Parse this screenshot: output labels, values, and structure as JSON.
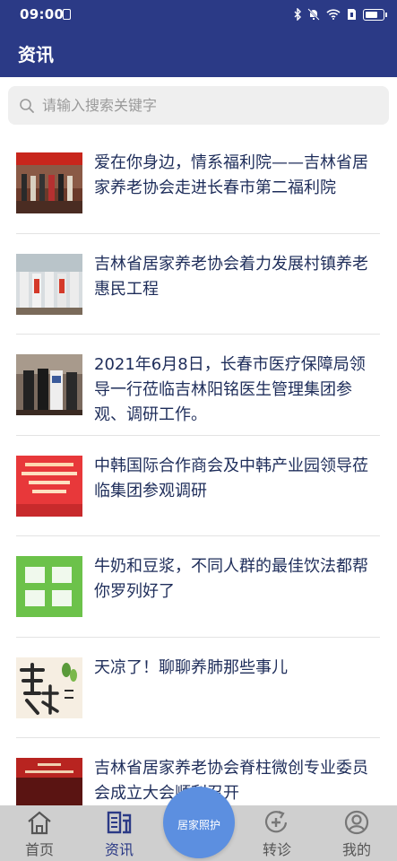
{
  "status_bar": {
    "time": "09:00"
  },
  "header": {
    "title": "资讯"
  },
  "search": {
    "placeholder": "请输入搜索关键字"
  },
  "news": [
    {
      "title": "爱在你身边，情系福利院——吉林省居家养老协会走进长春市第二福利院",
      "thumb": "event-photo-red-banner"
    },
    {
      "title": "吉林省居家养老协会着力发展村镇养老惠民工程",
      "thumb": "volunteers-photo"
    },
    {
      "title": "2021年6月8日，长春市医疗保障局领导一行莅临吉林阳铭医生管理集团参观、调研工作。",
      "thumb": "visit-photo"
    },
    {
      "title": "中韩国际合作商会及中韩产业园领导莅临集团参观调研",
      "thumb": "welcome-sign-image"
    },
    {
      "title": "牛奶和豆浆，不同人群的最佳饮法都帮你罗列好了",
      "thumb": "health-knowledge-image"
    },
    {
      "title": "天凉了！聊聊养肺那些事儿",
      "thumb": "lung-care-image"
    },
    {
      "title": "吉林省居家养老协会脊柱微创专业委员会成立大会顺利召开",
      "thumb": "conference-photo"
    }
  ],
  "tabbar": {
    "home": "首页",
    "news": "资讯",
    "center": "居家照护",
    "referral": "转诊",
    "mine": "我的"
  },
  "colors": {
    "header_bg": "#2b3a86",
    "active_tab": "#2b3a86",
    "fab_bg": "#5c8fe0"
  }
}
